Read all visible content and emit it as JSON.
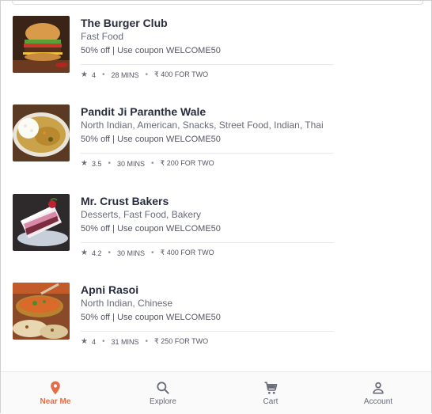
{
  "restaurants": [
    {
      "name": "The Burger Club",
      "cuisines": "Fast Food",
      "offer": "50% off | Use coupon WELCOME50",
      "rating": "4",
      "time": "28 MINS",
      "cost": "₹ 400 FOR TWO",
      "image": "burger-image"
    },
    {
      "name": "Pandit Ji Paranthe Wale",
      "cuisines": "North Indian, American, Snacks, Street Food, Indian, Thai",
      "offer": "50% off | Use coupon WELCOME50",
      "rating": "3.5",
      "time": "30 MINS",
      "cost": "₹ 200 FOR TWO",
      "image": "rice-curry-image"
    },
    {
      "name": "Mr. Crust Bakers",
      "cuisines": "Desserts, Fast Food, Bakery",
      "offer": "50% off | Use coupon WELCOME50",
      "rating": "4.2",
      "time": "30 MINS",
      "cost": "₹ 400 FOR TWO",
      "image": "cake-image"
    },
    {
      "name": "Apni Rasoi",
      "cuisines": "North Indian, Chinese",
      "offer": "50% off | Use coupon WELCOME50",
      "rating": "4",
      "time": "31 MINS",
      "cost": "₹ 250 FOR TWO",
      "image": "curry-bowl-image"
    }
  ],
  "nav": {
    "near_me": "Near Me",
    "explore": "Explore",
    "cart": "Cart",
    "account": "Account"
  },
  "colors": {
    "accent": "#e46d47",
    "text_primary": "#282c3f",
    "text_secondary": "#686b78"
  },
  "icons": {
    "rating": "star-icon",
    "near_me": "location-pin-icon",
    "explore": "search-icon",
    "cart": "cart-icon",
    "account": "user-icon"
  }
}
